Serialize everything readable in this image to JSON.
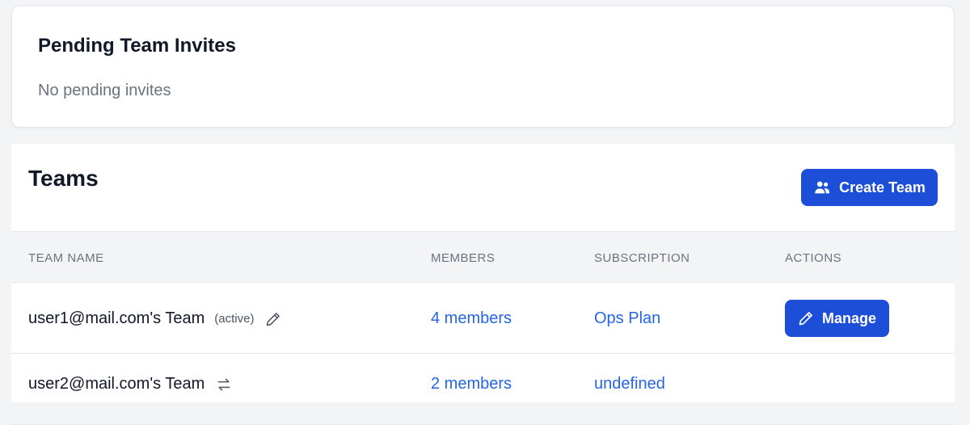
{
  "invites": {
    "title": "Pending Team Invites",
    "empty_message": "No pending invites"
  },
  "teams": {
    "title": "Teams",
    "create_button_label": "Create Team",
    "columns": [
      "TEAM NAME",
      "MEMBERS",
      "SUBSCRIPTION",
      "ACTIONS"
    ],
    "rows": [
      {
        "name": "user1@mail.com's Team",
        "status": "(active)",
        "members": "4 members",
        "subscription": "Ops Plan",
        "action_label": "Manage",
        "icon": "pencil-icon"
      },
      {
        "name": "user2@mail.com's Team",
        "members": "2 members",
        "subscription": "undefined",
        "icon": "swap-icon"
      }
    ]
  },
  "colors": {
    "primary": "#1d4ed8",
    "link": "#2563eb",
    "muted": "#6b7280",
    "header_bg": "#f3f4f6"
  }
}
